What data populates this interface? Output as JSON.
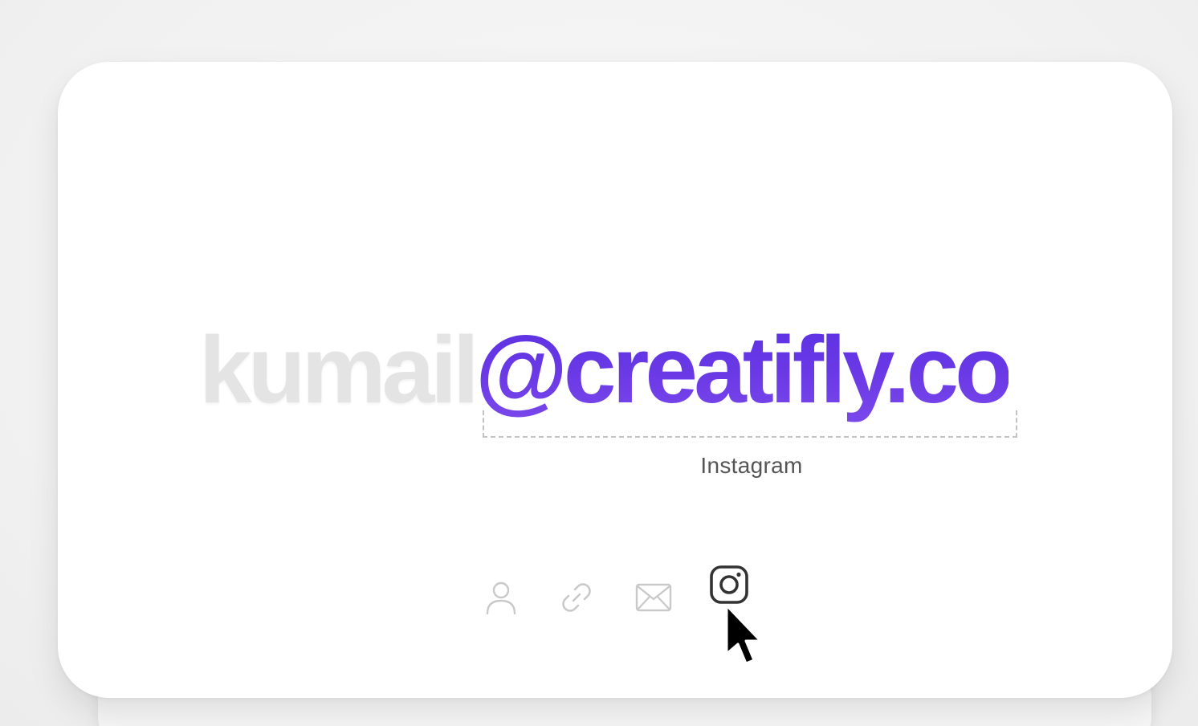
{
  "card": {
    "handle_prefix": "kumail",
    "handle_domain": "@creatifly.co",
    "tooltip": "Instagram"
  },
  "icons": [
    {
      "name": "profile-icon",
      "label": "profile",
      "active": false
    },
    {
      "name": "link-icon",
      "label": "link",
      "active": false
    },
    {
      "name": "mail-icon",
      "label": "email",
      "active": false
    },
    {
      "name": "instagram-icon",
      "label": "Instagram",
      "active": true
    }
  ],
  "colors": {
    "accent": "#6a38e0",
    "inactive_icon": "#c9c9c9",
    "active_icon": "#333333",
    "faded_text": "#e4e4e4"
  }
}
